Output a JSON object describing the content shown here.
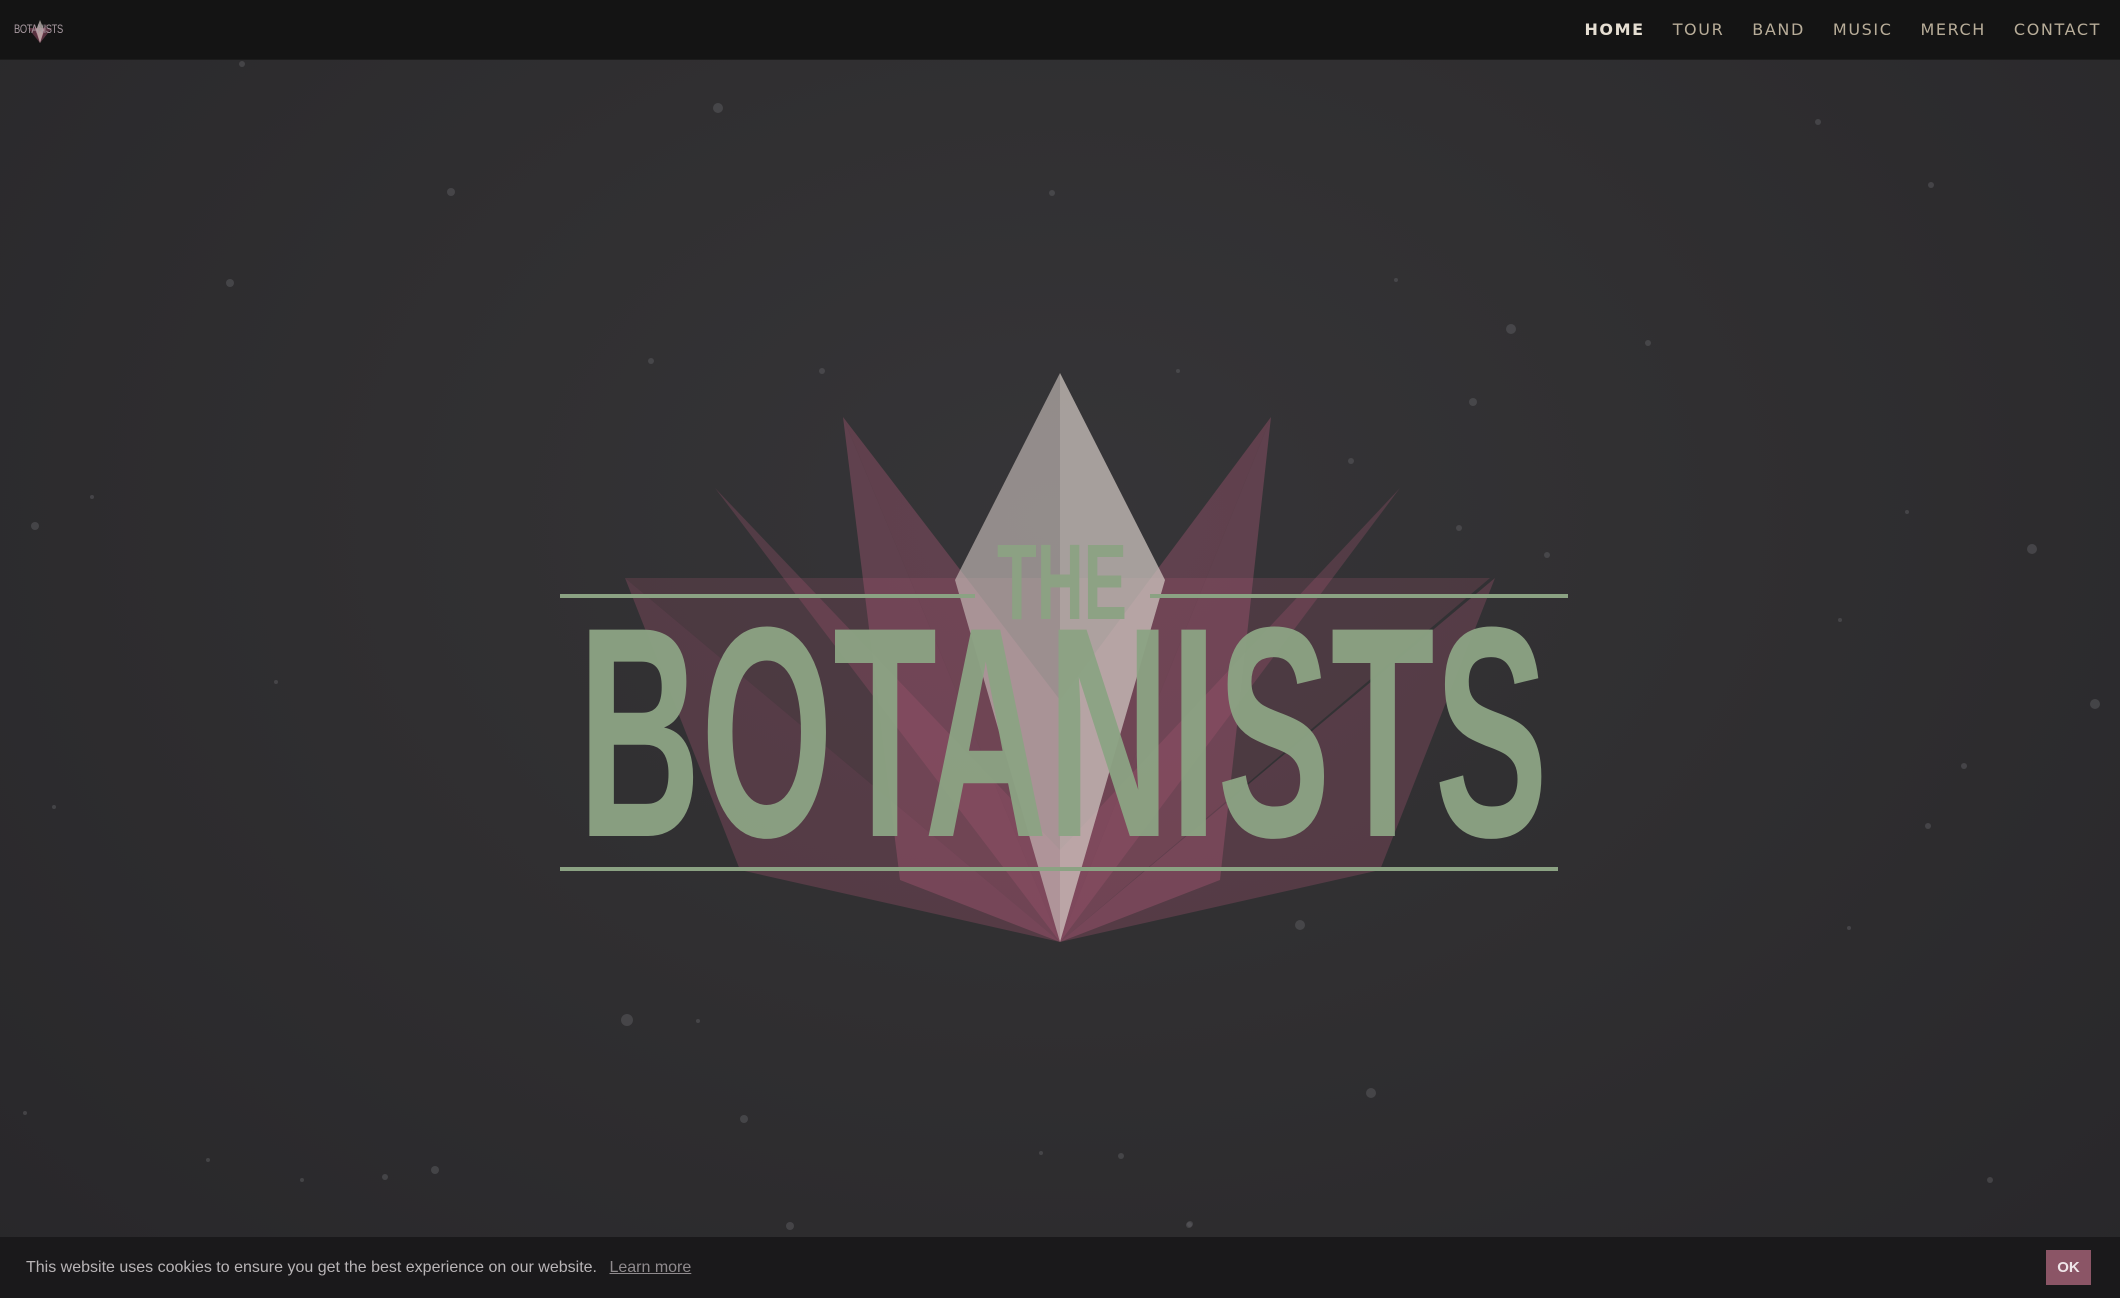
{
  "brand": {
    "logo_text": "BOTANISTS",
    "logo_icon": "lotus-icon"
  },
  "nav": {
    "items": [
      {
        "label": "HOME",
        "active": true
      },
      {
        "label": "TOUR"
      },
      {
        "label": "BAND"
      },
      {
        "label": "MUSIC"
      },
      {
        "label": "MERCH"
      },
      {
        "label": "CONTACT"
      }
    ]
  },
  "hero": {
    "line1": "THE",
    "line2": "BOTANISTS",
    "colors": {
      "text": "#8ba283",
      "petal": "#b05a75",
      "center": "#bdb4b0"
    }
  },
  "cookie": {
    "message": "This website uses cookies to ensure you get the best experience on our website.",
    "learn_more": "Learn more",
    "ok_label": "OK",
    "button_color": "#8b5566"
  }
}
